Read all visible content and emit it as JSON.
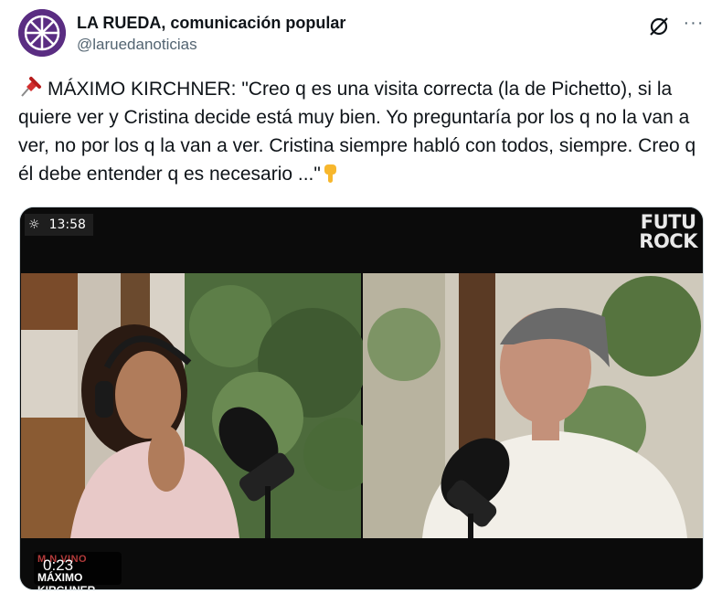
{
  "author": {
    "display_name": "LA RUEDA, comunicación popular",
    "handle": "@laruedanoticias"
  },
  "icons": {
    "avatar": "wheel-logo-icon",
    "grok": "grok-icon",
    "more": "more-icon",
    "pin": "pushpin-icon",
    "point_down": "point-down-icon"
  },
  "tweet": {
    "text": "MÁXIMO KIRCHNER: \"Creo q es una visita correcta (la de Pichetto), si la quiere ver y Cristina decide está muy bien. Yo preguntaría por los q no la van a ver, no por los q la van a ver. Cristina siempre habló con todos, siempre. Creo q él debe entender q es necesario ...\""
  },
  "video": {
    "clock": "13:58",
    "brand_line1": "FUTU",
    "brand_line2": "ROCK",
    "elapsed": "0:23",
    "lower_third_top": "M    N VINO",
    "lower_third_name": "MÁXIMO KIRCHNER"
  },
  "colors": {
    "avatar_bg": "#5a2d82",
    "text": "#0f1419",
    "secondary": "#536471"
  }
}
